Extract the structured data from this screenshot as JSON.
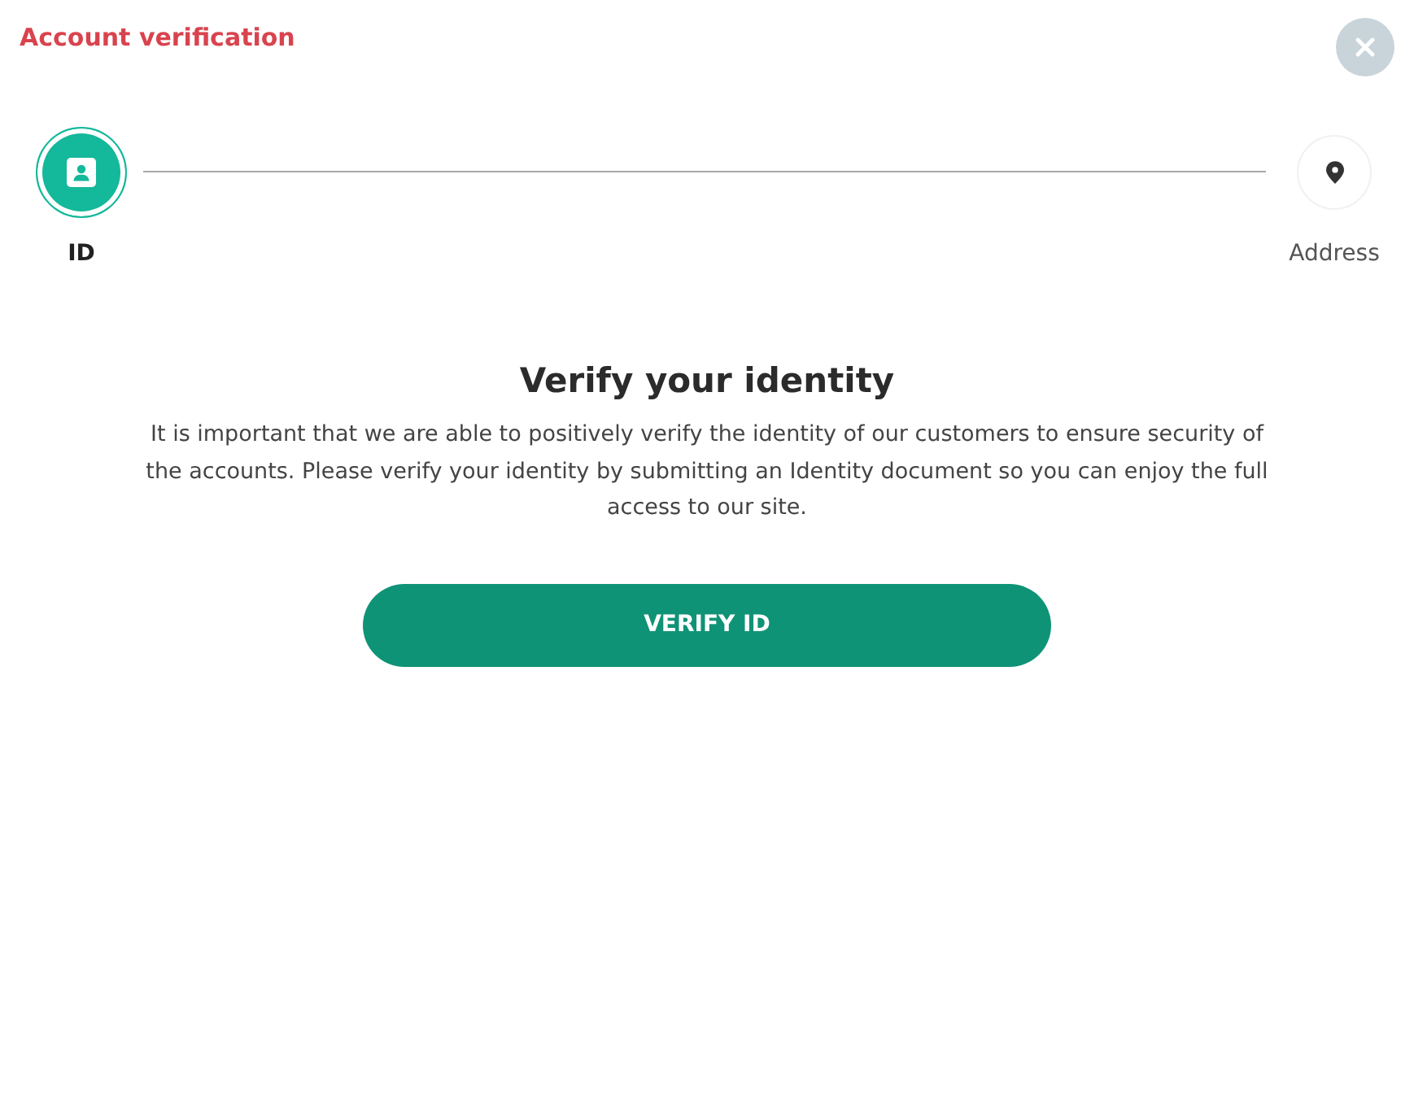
{
  "dialog": {
    "title": "Account verification"
  },
  "steps": [
    {
      "kind": "id",
      "label": "ID",
      "selected": true
    },
    {
      "kind": "address",
      "label": "Address",
      "selected": false
    }
  ],
  "content": {
    "heading": "Verify your identity",
    "text": "It is important that we are able to positively verify the identity of our customers to ensure security of the accounts. Please verify your identity by submitting an Identity document so you can enjoy the full access to our site."
  },
  "button": {
    "label": "VERIFY ID"
  }
}
